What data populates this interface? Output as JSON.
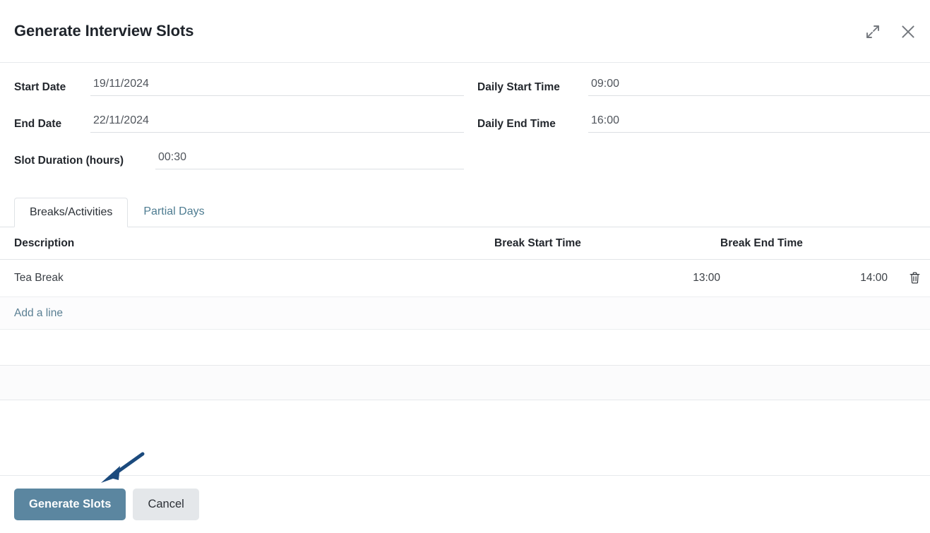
{
  "dialog": {
    "title": "Generate Interview Slots",
    "expand_icon": "expand-diagonal-icon",
    "close_icon": "close-x-icon"
  },
  "form": {
    "left": [
      {
        "label": "Start Date",
        "value": "19/11/2024",
        "placeholder": ""
      },
      {
        "label": "End Date",
        "value": "22/11/2024",
        "placeholder": ""
      },
      {
        "label": "Slot Duration (hours)",
        "value": "00:30",
        "placeholder": ""
      }
    ],
    "right": [
      {
        "label": "Daily Start Time",
        "value": "09:00",
        "placeholder": ""
      },
      {
        "label": "Daily End Time",
        "value": "16:00",
        "placeholder": ""
      }
    ]
  },
  "tabs": [
    {
      "label": "Breaks/Activities",
      "active": true
    },
    {
      "label": "Partial Days",
      "active": false
    }
  ],
  "table": {
    "headers": [
      "Description",
      "Break Start Time",
      "Break End Time"
    ],
    "rows": [
      {
        "description": "Tea Break",
        "break_start_time": "13:00",
        "break_end_time": "14:00",
        "delete_icon": "trash-icon"
      }
    ],
    "add_line_label": "Add a line"
  },
  "footer": {
    "primary_label": "Generate Slots",
    "secondary_label": "Cancel"
  },
  "colors": {
    "primary_button": "#5b86a0",
    "secondary_button": "#e4e7ea",
    "link": "#5a7f93",
    "tab_inactive": "#4e7c91",
    "annotation_arrow": "#1b4a7d",
    "text": "#23272d"
  }
}
